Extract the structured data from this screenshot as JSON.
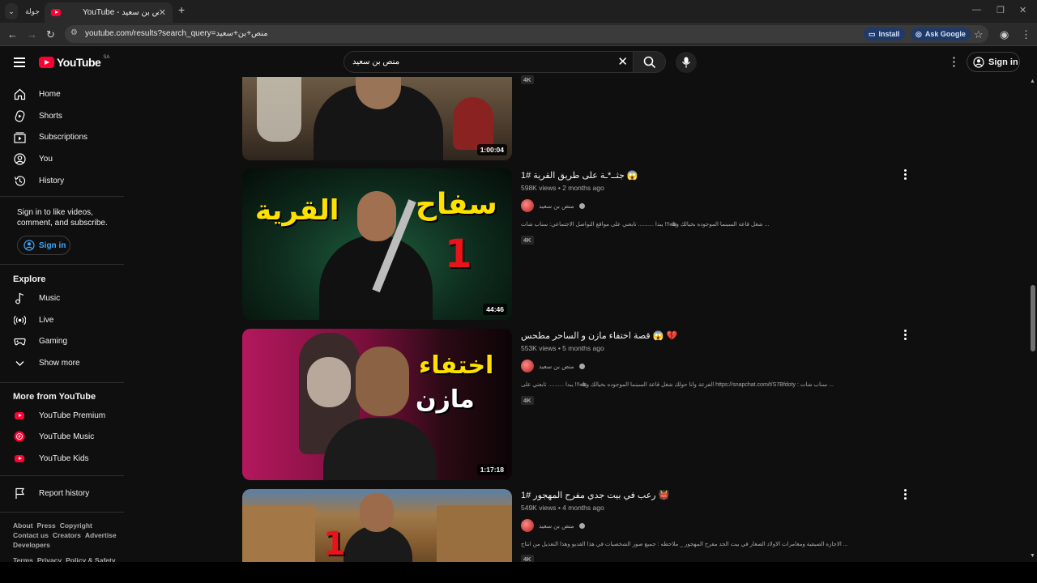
{
  "browser": {
    "pinned_tab_label": "جولة",
    "tab_title": "YouTube - منص بن سعيد",
    "url": "youtube.com/results?search_query=منص+بن+سعيد",
    "install_label": "Install",
    "ask_google_label": "Ask Google"
  },
  "header": {
    "logo_text": "YouTube",
    "region": "SA",
    "search_value": "منص بن سعيد",
    "signin_label": "Sign in"
  },
  "sidebar": {
    "main": [
      {
        "label": "Home",
        "icon": "home-icon"
      },
      {
        "label": "Shorts",
        "icon": "shorts-icon"
      },
      {
        "label": "Subscriptions",
        "icon": "subscriptions-icon"
      },
      {
        "label": "You",
        "icon": "you-icon"
      },
      {
        "label": "History",
        "icon": "history-icon"
      }
    ],
    "signin_prompt": "Sign in to like videos, comment, and subscribe.",
    "signin_button": "Sign in",
    "explore_heading": "Explore",
    "explore": [
      {
        "label": "Music",
        "icon": "music-icon"
      },
      {
        "label": "Live",
        "icon": "live-icon"
      },
      {
        "label": "Gaming",
        "icon": "gaming-icon"
      },
      {
        "label": "Show more",
        "icon": "chevron-down-icon"
      }
    ],
    "more_heading": "More from YouTube",
    "more": [
      {
        "label": "YouTube Premium",
        "icon": "youtube-premium-icon"
      },
      {
        "label": "YouTube Music",
        "icon": "youtube-music-icon"
      },
      {
        "label": "YouTube Kids",
        "icon": "youtube-kids-icon"
      }
    ],
    "report_history": "Report history",
    "footer_row1": [
      "About",
      "Press",
      "Copyright"
    ],
    "footer_row2": [
      "Contact us",
      "Creators",
      "Advertise"
    ],
    "footer_row3": [
      "Developers"
    ],
    "footer_row4": [
      "Terms",
      "Privacy",
      "Policy & Safety"
    ]
  },
  "results": [
    {
      "title": "",
      "meta": "",
      "channel": "",
      "description": "",
      "badge": "4K",
      "duration": "1:00:04"
    },
    {
      "title": "جثــ*ـة على طريق القرية #1 😱",
      "meta": "598K views • 2 months ago",
      "channel": "منص بن سعيد",
      "description": "شغل قاعة السينما الموجوده بخيالك وياﷲ!!! يبدا .......... تابعني على مواقع التواصل الاجتماعي: سناب شات ...",
      "badge": "4K",
      "duration": "44:46",
      "thumb_text_a": "سفاح",
      "thumb_text_b": "القرية",
      "thumb_text_c": "1"
    },
    {
      "title": "قصة اختفاء مازن و الساحر مطحس 😱 💔",
      "meta": "553K views • 5 months ago",
      "channel": "منص بن سعيد",
      "description": "الفزعة وانا حولك شغل قاعة السينما الموجوده بخيالك وياﷲ!!! يبدا .......... تابعني على https://snapchat.com/t/S7Bfdoty : سناب شات ...",
      "badge": "4K",
      "duration": "1:17:18",
      "thumb_text_a": "اختفاء",
      "thumb_text_b": "مازن"
    },
    {
      "title": "رعب في بيت جدي مفرح المهجور #1 👹",
      "meta": "549K views • 4 months ago",
      "channel": "منص بن سعيد",
      "description": "الاجازه الصيفية ومغامرات الاولاد الصغار في بيت الجد مفرح المهجور _ ملاحظه : جميع صور الشخصيات في هذا الفديو وهذا التعديل من انتاج ...",
      "badge": "4K",
      "duration": "",
      "thumb_text_a": "1"
    }
  ],
  "colors": {
    "background": "#0f0f0f",
    "youtube_red": "#ff0033",
    "accent_blue": "#3ea6ff",
    "thumb_yellow": "#ffe100"
  }
}
